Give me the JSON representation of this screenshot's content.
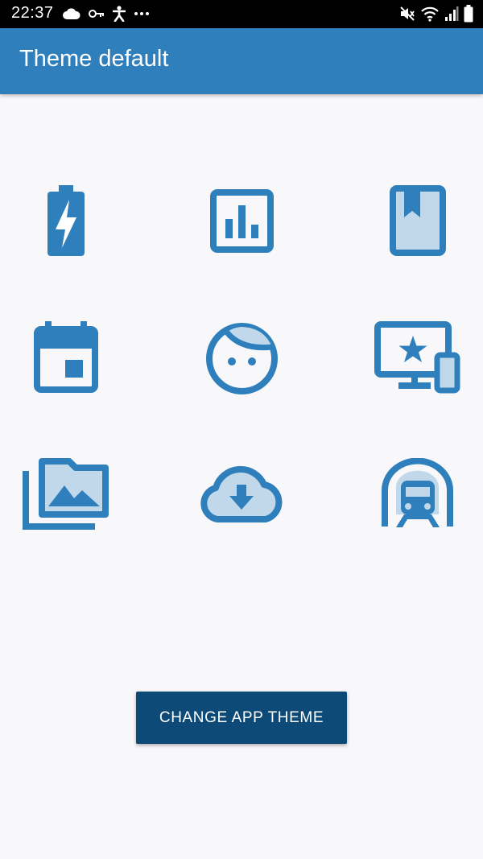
{
  "status_bar": {
    "time": "22:37",
    "left_icons": [
      "cloud-icon",
      "key-icon",
      "accessibility-icon",
      "more-dots-icon"
    ],
    "right_icons": [
      "mute-icon",
      "wifi-icon",
      "signal-icon",
      "battery-icon"
    ]
  },
  "app_bar": {
    "title": "Theme default"
  },
  "colors": {
    "primary": "#2e7fbc",
    "primary_dark": "#0e4a78",
    "icon_fill_light": "#c1d8ea",
    "background": "#f8f7fa"
  },
  "icons": [
    "battery-charging-icon",
    "bar-chart-icon",
    "bookmark-book-icon",
    "calendar-icon",
    "face-icon",
    "devices-star-icon",
    "photo-library-icon",
    "cloud-download-icon",
    "subway-icon"
  ],
  "button": {
    "label": "CHANGE APP THEME"
  }
}
